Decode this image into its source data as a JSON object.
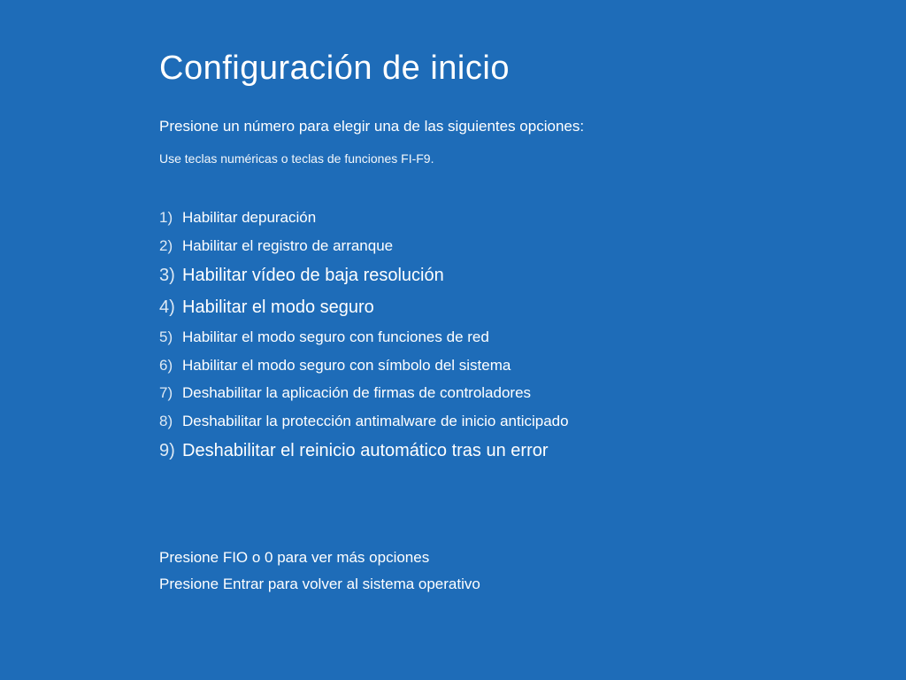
{
  "title": "Configuración de inicio",
  "instruction": "Presione un número para elegir una de las siguientes opciones:",
  "hint": "Use teclas numéricas o teclas de funciones FI-F9.",
  "options": [
    {
      "num": "1)",
      "label": "Habilitar depuración",
      "emph": false
    },
    {
      "num": "2)",
      "label": "Habilitar el registro de arranque",
      "emph": false
    },
    {
      "num": "3)",
      "label": "Habilitar vídeo de baja resolución",
      "emph": true
    },
    {
      "num": "4)",
      "label": "Habilitar el modo seguro",
      "emph": true
    },
    {
      "num": "5)",
      "label": "Habilitar el modo seguro con funciones de red",
      "emph": false
    },
    {
      "num": "6)",
      "label": "Habilitar el modo seguro con símbolo del sistema",
      "emph": false
    },
    {
      "num": "7)",
      "label": "Deshabilitar la aplicación de firmas de controladores",
      "emph": false
    },
    {
      "num": "8)",
      "label": "Deshabilitar la protección antimalware de inicio anticipado",
      "emph": false
    },
    {
      "num": "9)",
      "label": "Deshabilitar el reinicio automático tras un error",
      "emph": true
    }
  ],
  "footer": {
    "more_options": "Presione FIO o 0 para ver más opciones",
    "return_os": "Presione Entrar para volver al sistema operativo"
  }
}
